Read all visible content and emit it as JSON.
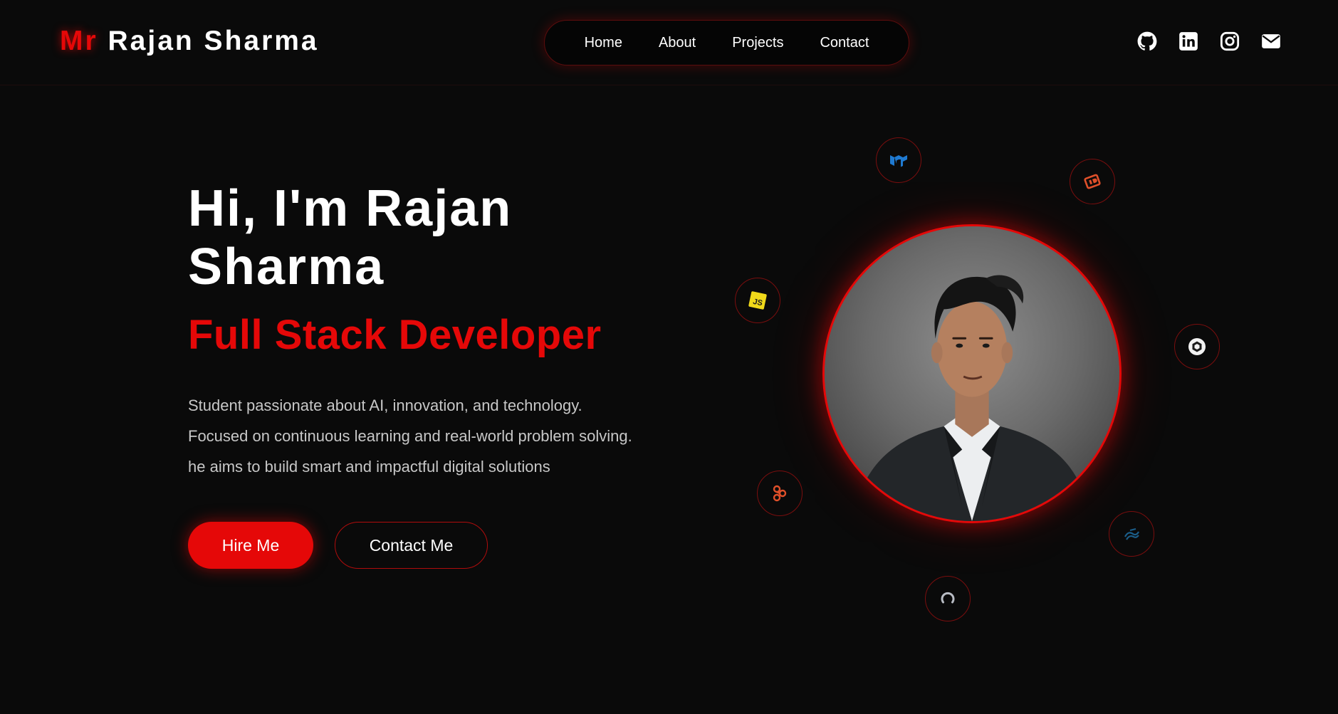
{
  "brand": {
    "prefix": "Mr",
    "name": "Rajan Sharma"
  },
  "nav": {
    "items": [
      "Home",
      "About",
      "Projects",
      "Contact"
    ]
  },
  "socials": [
    "github-icon",
    "linkedin-icon",
    "instagram-icon",
    "email-icon"
  ],
  "hero": {
    "title": "Hi, I'm Rajan Sharma",
    "subtitle": "Full Stack Developer",
    "description": [
      "Student passionate about AI, innovation, and technology.",
      "Focused on continuous learning and real-world problem solving.",
      "he aims to build smart and impactful digital solutions"
    ],
    "primary_button": "Hire Me",
    "secondary_button": "Contact Me"
  },
  "profile": {
    "image": "profile-photo"
  },
  "tech_icons": [
    "mui-icon",
    "ideas-icon",
    "javascript-icon",
    "unity-icon",
    "figma-icon",
    "tailwind-icon",
    "loader-icon"
  ],
  "colors": {
    "background": "#0a0a0a",
    "accent": "#e50808",
    "text": "#ffffff",
    "muted_text": "#c7c7c7"
  }
}
